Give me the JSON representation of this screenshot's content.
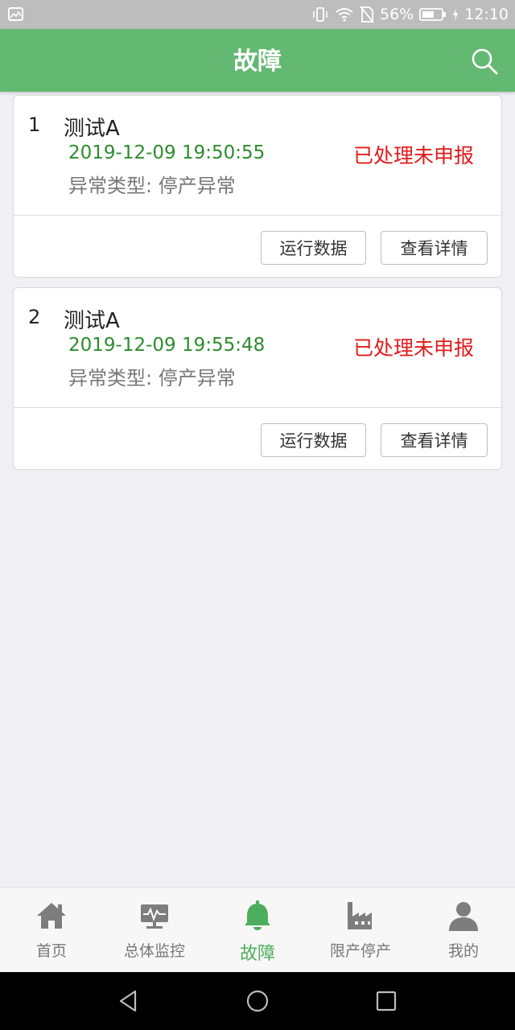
{
  "status_bar": {
    "battery": "56%",
    "time": "12:10"
  },
  "header": {
    "title": "故障"
  },
  "faults": [
    {
      "index": "1",
      "name": "测试A",
      "time": "2019-12-09 19:50:55",
      "status": "已处理未申报",
      "type": "异常类型: 停产异常",
      "run_button": "运行数据",
      "detail_button": "查看详情"
    },
    {
      "index": "2",
      "name": "测试A",
      "time": "2019-12-09 19:55:48",
      "status": "已处理未申报",
      "type": "异常类型: 停产异常",
      "run_button": "运行数据",
      "detail_button": "查看详情"
    }
  ],
  "tabs": [
    {
      "label": "首页",
      "icon": "home-icon"
    },
    {
      "label": "总体监控",
      "icon": "monitor-icon"
    },
    {
      "label": "故障",
      "icon": "bell-icon",
      "active": true
    },
    {
      "label": "限产停产",
      "icon": "factory-icon"
    },
    {
      "label": "我的",
      "icon": "user-icon"
    }
  ],
  "colors": {
    "primary": "#63b872",
    "active_tab": "#4cae5c",
    "time_text": "#2e8b2e",
    "status_text": "#e01b1b"
  }
}
